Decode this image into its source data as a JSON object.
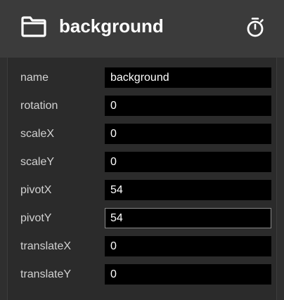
{
  "header": {
    "title": "background",
    "folder_icon": "folder-icon",
    "timer_icon": "stopwatch-icon"
  },
  "properties": [
    {
      "label": "name",
      "value": "background",
      "focused": false
    },
    {
      "label": "rotation",
      "value": "0",
      "focused": false
    },
    {
      "label": "scaleX",
      "value": "0",
      "focused": false
    },
    {
      "label": "scaleY",
      "value": "0",
      "focused": false
    },
    {
      "label": "pivotX",
      "value": "54",
      "focused": false
    },
    {
      "label": "pivotY",
      "value": "54",
      "focused": true
    },
    {
      "label": "translateX",
      "value": "0",
      "focused": false
    },
    {
      "label": "translateY",
      "value": "0",
      "focused": false
    }
  ],
  "colors": {
    "header_bg": "#3b3b3b",
    "panel_bg": "#2f2f2f",
    "field_bg": "#000000",
    "label_text": "#d2d2d2",
    "focus_border": "#8a8a8a"
  }
}
